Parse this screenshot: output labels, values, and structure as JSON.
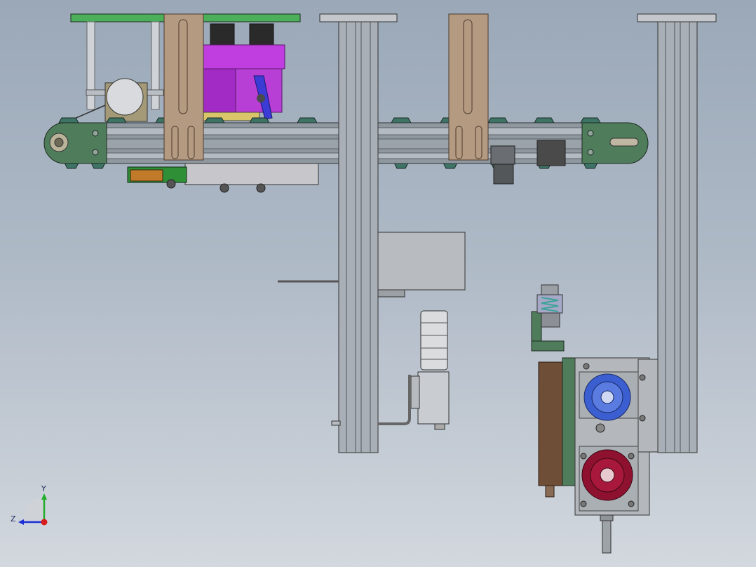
{
  "view": {
    "background_top": "#9aa8b8",
    "background_bottom": "#d3d8de"
  },
  "triad": {
    "y_label": "Y",
    "z_label": "Z",
    "y_color": "#1fae2c",
    "z_color": "#1b2fd6",
    "x_color": "#d61b1b"
  },
  "colors": {
    "profile_gray": "#a9afb6",
    "conveyor_green": "#4f7d5c",
    "plate_green": "#4cb05a",
    "bracket_tan": "#b59a82",
    "cylinder_magenta": "#a12bc4",
    "gear_blue": "#3b5fd0",
    "gear_red": "#8e1230",
    "stem_brown": "#6f4e37",
    "spring_teal": "#3fa39a"
  }
}
